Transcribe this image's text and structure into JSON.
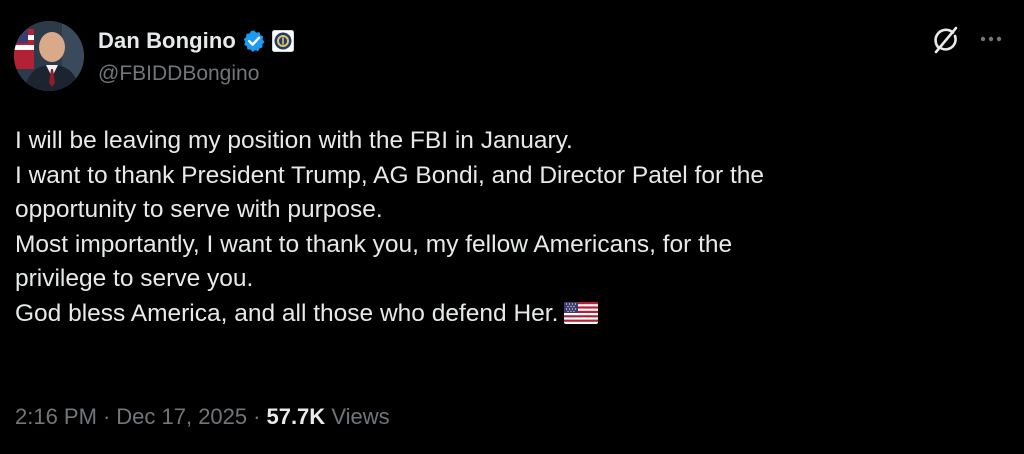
{
  "author": {
    "display_name": "Dan Bongino",
    "handle": "@FBIDDBongino",
    "verified_badge": "verified-badge-icon",
    "affiliate_badge": "fbi-seal-icon",
    "avatar": "user-avatar"
  },
  "actions": {
    "grok_icon": "grok-icon",
    "more_icon": "more-options-icon"
  },
  "tweet": {
    "lines": [
      "I will be leaving my position with the FBI in January.",
      "I want to thank President Trump, AG Bondi, and Director Patel for the",
      "opportunity to serve with purpose.",
      "Most importantly, I want to thank you, my fellow Americans, for the",
      "privilege to serve you.",
      "God bless America, and all those who defend Her."
    ],
    "emoji": "us-flag-emoji"
  },
  "meta": {
    "time": "2:16 PM",
    "separator": "·",
    "date": "Dec 17, 2025",
    "views_count": "57.7K",
    "views_label": "Views"
  },
  "colors": {
    "background": "#000000",
    "primary_text": "#e7e9ea",
    "secondary_text": "#71767b",
    "verified_blue": "#1d9bf0"
  }
}
